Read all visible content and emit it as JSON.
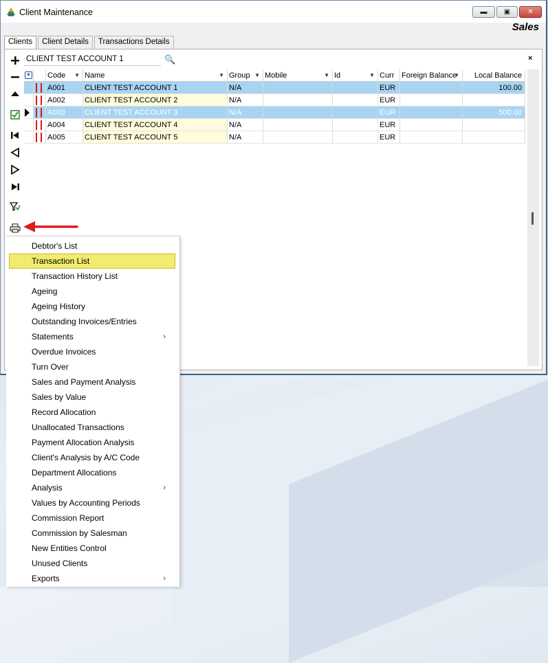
{
  "window": {
    "title": "Client Maintenance",
    "module": "Sales",
    "min_glyph": "▬",
    "max_glyph": "▣",
    "close_glyph": "✕"
  },
  "tabs": [
    "Clients",
    "Client Details",
    "Transactions Details"
  ],
  "search": {
    "value": "CLIENT TEST ACCOUNT 1",
    "find_glyph": "🔍",
    "clear_glyph": "×"
  },
  "toolbar_icons": [
    "add-icon",
    "remove-icon",
    "up-icon",
    "edit-check-icon",
    "first-record-icon",
    "previous-record-icon",
    "next-record-icon",
    "last-record-icon",
    "filter-icon",
    "print-icon"
  ],
  "grid": {
    "columns": [
      "Code",
      "Name",
      "Group",
      "Mobile",
      "Id",
      "Curr",
      "Foreign Balance",
      "Local Balance"
    ],
    "rows": [
      {
        "code": "A001",
        "name": "CLIENT TEST ACCOUNT 1",
        "group": "N/A",
        "mobile": "",
        "id": "",
        "curr": "EUR",
        "foreign_balance": "",
        "local_balance": "100.00"
      },
      {
        "code": "A002",
        "name": "CLIENT TEST ACCOUNT 2",
        "group": "N/A",
        "mobile": "",
        "id": "",
        "curr": "EUR",
        "foreign_balance": "",
        "local_balance": ""
      },
      {
        "code": "A003",
        "name": "CLIENT TEST ACCOUNT 3",
        "group": "N/A",
        "mobile": "",
        "id": "",
        "curr": "EUR",
        "foreign_balance": "",
        "local_balance": "500.00"
      },
      {
        "code": "A004",
        "name": "CLIENT TEST ACCOUNT 4",
        "group": "N/A",
        "mobile": "",
        "id": "",
        "curr": "EUR",
        "foreign_balance": "",
        "local_balance": ""
      },
      {
        "code": "A005",
        "name": "CLIENT TEST ACCOUNT 5",
        "group": "N/A",
        "mobile": "",
        "id": "",
        "curr": "EUR",
        "foreign_balance": "",
        "local_balance": ""
      }
    ]
  },
  "menu": {
    "items": [
      {
        "label": "Debtor's List",
        "submenu": false
      },
      {
        "label": "Transaction List",
        "submenu": false,
        "highlighted": true
      },
      {
        "label": "Transaction History List",
        "submenu": false
      },
      {
        "label": "Ageing",
        "submenu": false
      },
      {
        "label": "Ageing History",
        "submenu": false
      },
      {
        "label": "Outstanding Invoices/Entries",
        "submenu": false
      },
      {
        "label": "Statements",
        "submenu": true
      },
      {
        "label": "Overdue Invoices",
        "submenu": false
      },
      {
        "label": "Turn Over",
        "submenu": false
      },
      {
        "label": "Sales and Payment Analysis",
        "submenu": false
      },
      {
        "label": "Sales by Value",
        "submenu": false
      },
      {
        "label": "Record Allocation",
        "submenu": false
      },
      {
        "label": "Unallocated Transactions",
        "submenu": false
      },
      {
        "label": "Payment Allocation Analysis",
        "submenu": false
      },
      {
        "label": "Client's Analysis by A/C Code",
        "submenu": false
      },
      {
        "label": "Department Allocations",
        "submenu": false
      },
      {
        "label": "Analysis",
        "submenu": true
      },
      {
        "label": "Values by Accounting Periods",
        "submenu": false
      },
      {
        "label": "Commission Report",
        "submenu": false
      },
      {
        "label": "Commission by Salesman",
        "submenu": false
      },
      {
        "label": "New Entities Control",
        "submenu": false
      },
      {
        "label": "Unused Clients",
        "submenu": false
      },
      {
        "label": "Exports",
        "submenu": true
      }
    ],
    "submenu_glyph": "›"
  },
  "colors": {
    "row_highlight": "#a8d4f2",
    "name_cell": "#fffbdc",
    "menu_highlight": "#f0ec6e",
    "annotation_arrow": "#e01b1b"
  }
}
